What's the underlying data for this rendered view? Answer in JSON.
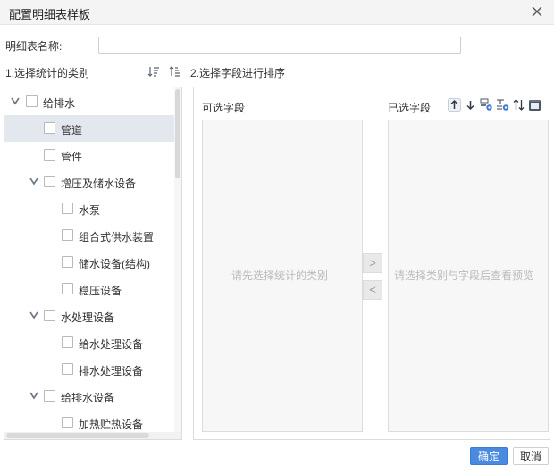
{
  "dialog": {
    "title": "配置明细表样板"
  },
  "name_field": {
    "label": "明细表名称:",
    "value": "",
    "placeholder": ""
  },
  "section1": {
    "title": "1.选择统计的类别"
  },
  "section2": {
    "title": "2.选择字段进行排序"
  },
  "tree": {
    "nodes": [
      {
        "label": "给排水",
        "level": 0,
        "expanded": true,
        "checked": false,
        "selected": false
      },
      {
        "label": "管道",
        "level": 1,
        "expanded": null,
        "checked": false,
        "selected": true
      },
      {
        "label": "管件",
        "level": 1,
        "expanded": null,
        "checked": false,
        "selected": false
      },
      {
        "label": "增压及储水设备",
        "level": 1,
        "expanded": true,
        "checked": false,
        "selected": false
      },
      {
        "label": "水泵",
        "level": 2,
        "expanded": null,
        "checked": false,
        "selected": false
      },
      {
        "label": "组合式供水装置",
        "level": 2,
        "expanded": null,
        "checked": false,
        "selected": false
      },
      {
        "label": "储水设备(结构)",
        "level": 2,
        "expanded": null,
        "checked": false,
        "selected": false
      },
      {
        "label": "稳压设备",
        "level": 2,
        "expanded": null,
        "checked": false,
        "selected": false
      },
      {
        "label": "水处理设备",
        "level": 1,
        "expanded": true,
        "checked": false,
        "selected": false
      },
      {
        "label": "给水处理设备",
        "level": 2,
        "expanded": null,
        "checked": false,
        "selected": false
      },
      {
        "label": "排水处理设备",
        "level": 2,
        "expanded": null,
        "checked": false,
        "selected": false
      },
      {
        "label": "给排水设备",
        "level": 1,
        "expanded": true,
        "checked": false,
        "selected": false
      },
      {
        "label": "加热贮热设备",
        "level": 2,
        "expanded": null,
        "checked": false,
        "selected": false
      }
    ]
  },
  "available_fields": {
    "title": "可选字段",
    "empty_text": "请先选择统计的类别"
  },
  "selected_fields": {
    "title": "已选字段",
    "empty_text": "请选择类别与字段后查看预览"
  },
  "transfer": {
    "add_label": ">",
    "remove_label": "<"
  },
  "toolbar_icons": [
    "move-up-icon",
    "move-down-icon",
    "field-settings-icon",
    "format-settings-icon",
    "sort-icon",
    "delete-icon"
  ],
  "footer": {
    "ok_label": "确定",
    "cancel_label": "取消"
  },
  "colors": {
    "primary": "#4a8be0",
    "selected_row": "#e3e7ee",
    "border": "#dcdcdc",
    "placeholder": "#bbbbbb",
    "icon": "#4c5766"
  }
}
